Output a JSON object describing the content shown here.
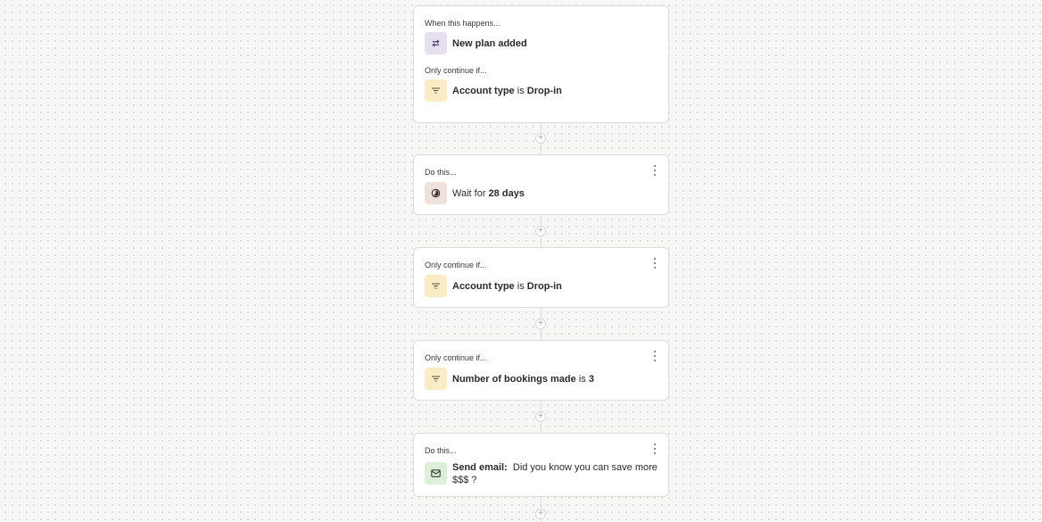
{
  "trigger_card": {
    "when_label": "When this happens...",
    "trigger_icon": "repeat-arrows-icon",
    "trigger_text": "New plan added",
    "condition_label": "Only continue if...",
    "condition_icon": "filter-icon",
    "condition_field": "Account type",
    "condition_op": "is",
    "condition_value": "Drop-in"
  },
  "steps": [
    {
      "label": "Do this...",
      "icon": "timer-icon",
      "prefix": "Wait for",
      "value": "28 days"
    },
    {
      "label": "Only continue if...",
      "icon": "filter-icon",
      "field": "Account type",
      "op": "is",
      "value": "Drop-in"
    },
    {
      "label": "Only continue if...",
      "icon": "filter-icon",
      "field": "Number of bookings made",
      "op": "is",
      "value": "3"
    },
    {
      "label": "Do this...",
      "icon": "envelope-icon",
      "action": "Send email:",
      "subject_line1": "Did you know you can save more",
      "subject_line2": "$$$ ?"
    }
  ],
  "add_step_symbol": "+"
}
